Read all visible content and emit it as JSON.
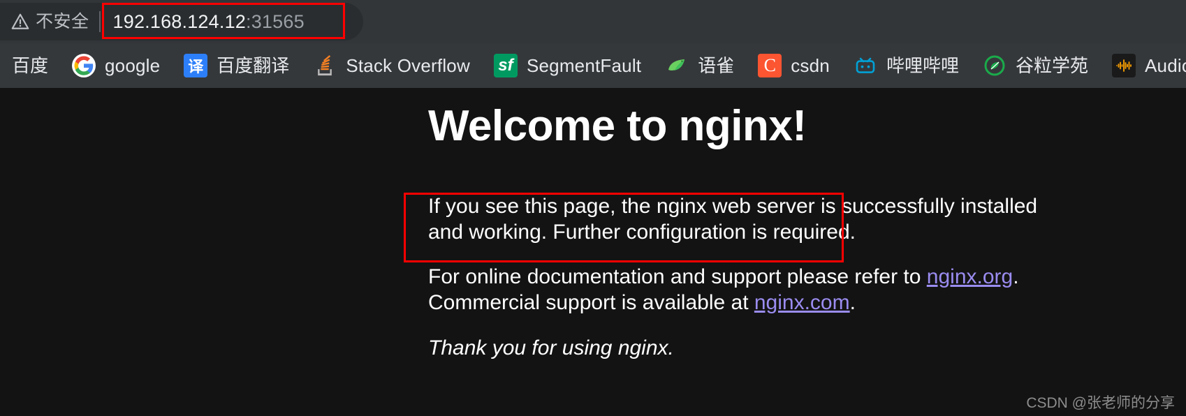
{
  "browser": {
    "omnibox": {
      "security_icon": "warning-triangle-icon",
      "security_label": "不安全",
      "url_host": "192.168.124.12",
      "url_port": ":31565",
      "url_full": "192.168.124.12:31565"
    },
    "bookmarks": [
      {
        "icon": "baidu-icon",
        "label": "百度",
        "cjk": true
      },
      {
        "icon": "google-icon",
        "label": "google",
        "cjk": false
      },
      {
        "icon": "baidu-fanyi-icon",
        "label": "百度翻译",
        "cjk": true
      },
      {
        "icon": "stackoverflow-icon",
        "label": "Stack Overflow",
        "cjk": false
      },
      {
        "icon": "segmentfault-icon",
        "label": "SegmentFault",
        "cjk": false
      },
      {
        "icon": "yuque-icon",
        "label": "语雀",
        "cjk": true
      },
      {
        "icon": "csdn-icon",
        "label": "csdn",
        "cjk": false
      },
      {
        "icon": "bilibili-icon",
        "label": "哔哩哔哩",
        "cjk": true
      },
      {
        "icon": "guli-xueyuan-icon",
        "label": "谷粒学苑",
        "cjk": true
      },
      {
        "icon": "audiomack-icon",
        "label": "Audiomack",
        "cjk": false
      }
    ]
  },
  "page": {
    "heading": "Welcome to nginx!",
    "paragraph_1": "If you see this page, the nginx web server is successfully installed and working. Further configuration is required.",
    "paragraph_2_pre": "For online documentation and support please refer to ",
    "link_org": "nginx.org",
    "paragraph_2_mid": ". Commercial support is available at ",
    "link_com": "nginx.com",
    "paragraph_2_post": ".",
    "paragraph_3": "Thank you for using nginx."
  },
  "annotations": {
    "url_box_color": "#ff0000",
    "heading_box_color": "#ff0000"
  },
  "watermark": {
    "text": "CSDN @张老师的分享"
  },
  "colors": {
    "chrome_bg": "#323639",
    "bookmarks_bg": "#35383b",
    "omnibox_bg": "#2a2d2f",
    "page_bg": "#131313",
    "link": "#9a8cf0",
    "text": "#ffffff",
    "muted_text": "#9aa0a6"
  }
}
